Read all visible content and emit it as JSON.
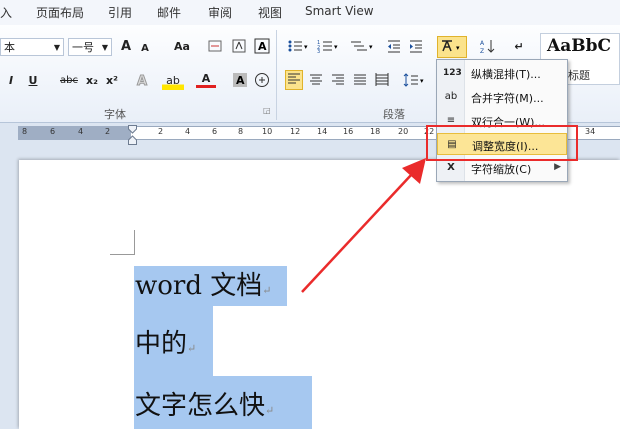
{
  "tabs": [
    "入",
    "页面布局",
    "引用",
    "邮件",
    "审阅",
    "视图",
    "Smart View"
  ],
  "font_group": {
    "font_name": "本",
    "font_size": "一号",
    "label": "字体",
    "buttons": {
      "grow": "A",
      "shrink": "A",
      "case": "Aa",
      "underline": "U",
      "strike": "abc",
      "sub": "x₂",
      "sup": "x²",
      "highlight": "ab",
      "color": "A"
    }
  },
  "paragraph_group": {
    "label": "段落"
  },
  "styles": {
    "sample": "AaBbC",
    "caption": "标题"
  },
  "ruler": [
    "8",
    "6",
    "4",
    "2",
    "",
    "2",
    "4",
    "6",
    "8",
    "10",
    "12",
    "14",
    "16",
    "18",
    "20",
    "22",
    "",
    "",
    "",
    "",
    "34"
  ],
  "document": {
    "lines": [
      "word 文档",
      "中的",
      "文字怎么快"
    ]
  },
  "menu": {
    "items": [
      {
        "label": "纵横混排(T)...",
        "icon": "123"
      },
      {
        "label": "合并字符(M)...",
        "icon": "ab"
      },
      {
        "label": "双行合一(W)...",
        "icon": "≡"
      },
      {
        "label": "调整宽度(I)...",
        "icon": "▤"
      },
      {
        "label": "字符缩放(C)",
        "icon": "X"
      }
    ]
  },
  "colors": {
    "accent_red": "#ea2b2b",
    "selection": "#a6c8f0",
    "highlight": "#fce596"
  }
}
